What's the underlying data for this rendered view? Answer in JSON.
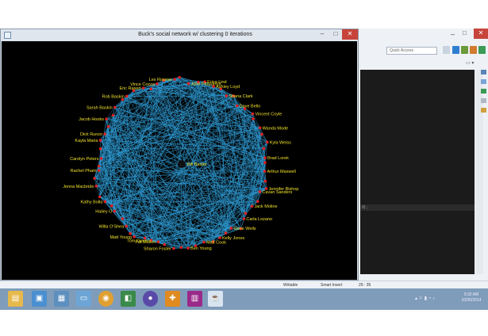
{
  "graph_window": {
    "title": "Buck's social network w/ clustering 0 iterations",
    "buttons": {
      "minimize": "–",
      "maximize": "□",
      "close": "✕"
    },
    "icon": "java-app-icon"
  },
  "graph": {
    "colors": {
      "background": "#000000",
      "edge": "#2f9ed8",
      "node": "#e02020",
      "label": "#f2e22a"
    },
    "center_label": "Bill Baxter",
    "labels": [
      "Erica Lind",
      "Ashley Loyd",
      "Shana Clark",
      "Dave Bello",
      "Vincent Coyle",
      "Wanda Mode",
      "Kyla Weiss",
      "Brad Lorek",
      "Arthur Maxwell",
      "Jennifer Bishop",
      "Cavan Sanders",
      "Jack Moline",
      "Carla Lozano",
      "Gene Wells",
      "Kelly Jones",
      "Matt Cook",
      "Ben Young",
      "Sharon Foster",
      "Pat Mullen",
      "Tom Dwyer",
      "Matt Young",
      "Willa O'Shea",
      "Hailey O",
      "Kathy Bolla",
      "Jenna Macbride",
      "Rachel Pham",
      "Carolyn Peters",
      "Kayla Maria",
      "Dick Runzo",
      "Jacob Hooks",
      "Sarah Baskin",
      "Rob Baskin",
      "Eric Rasert",
      "Vince Cozza",
      "Les Rowner",
      "John Fitzpatrick"
    ]
  },
  "eclipse": {
    "quick_access_placeholder": "Quick Access",
    "window_buttons": {
      "minimize": "–",
      "maximize": "□",
      "close": "✕"
    },
    "console_text": "0) ;"
  },
  "status_bar": {
    "writable": "Writable",
    "insert_mode": "Smart Insert",
    "position": "29 : 35"
  },
  "taskbar": {
    "apps": [
      "file-explorer-icon",
      "photos-icon",
      "scanner-icon",
      "folder-icon",
      "chrome-icon",
      "app-icon",
      "media-icon",
      "puzzle-icon",
      "winrar-icon",
      "java-icon"
    ],
    "clock_time": "9:32 AM",
    "clock_date": "10/26/2014"
  }
}
